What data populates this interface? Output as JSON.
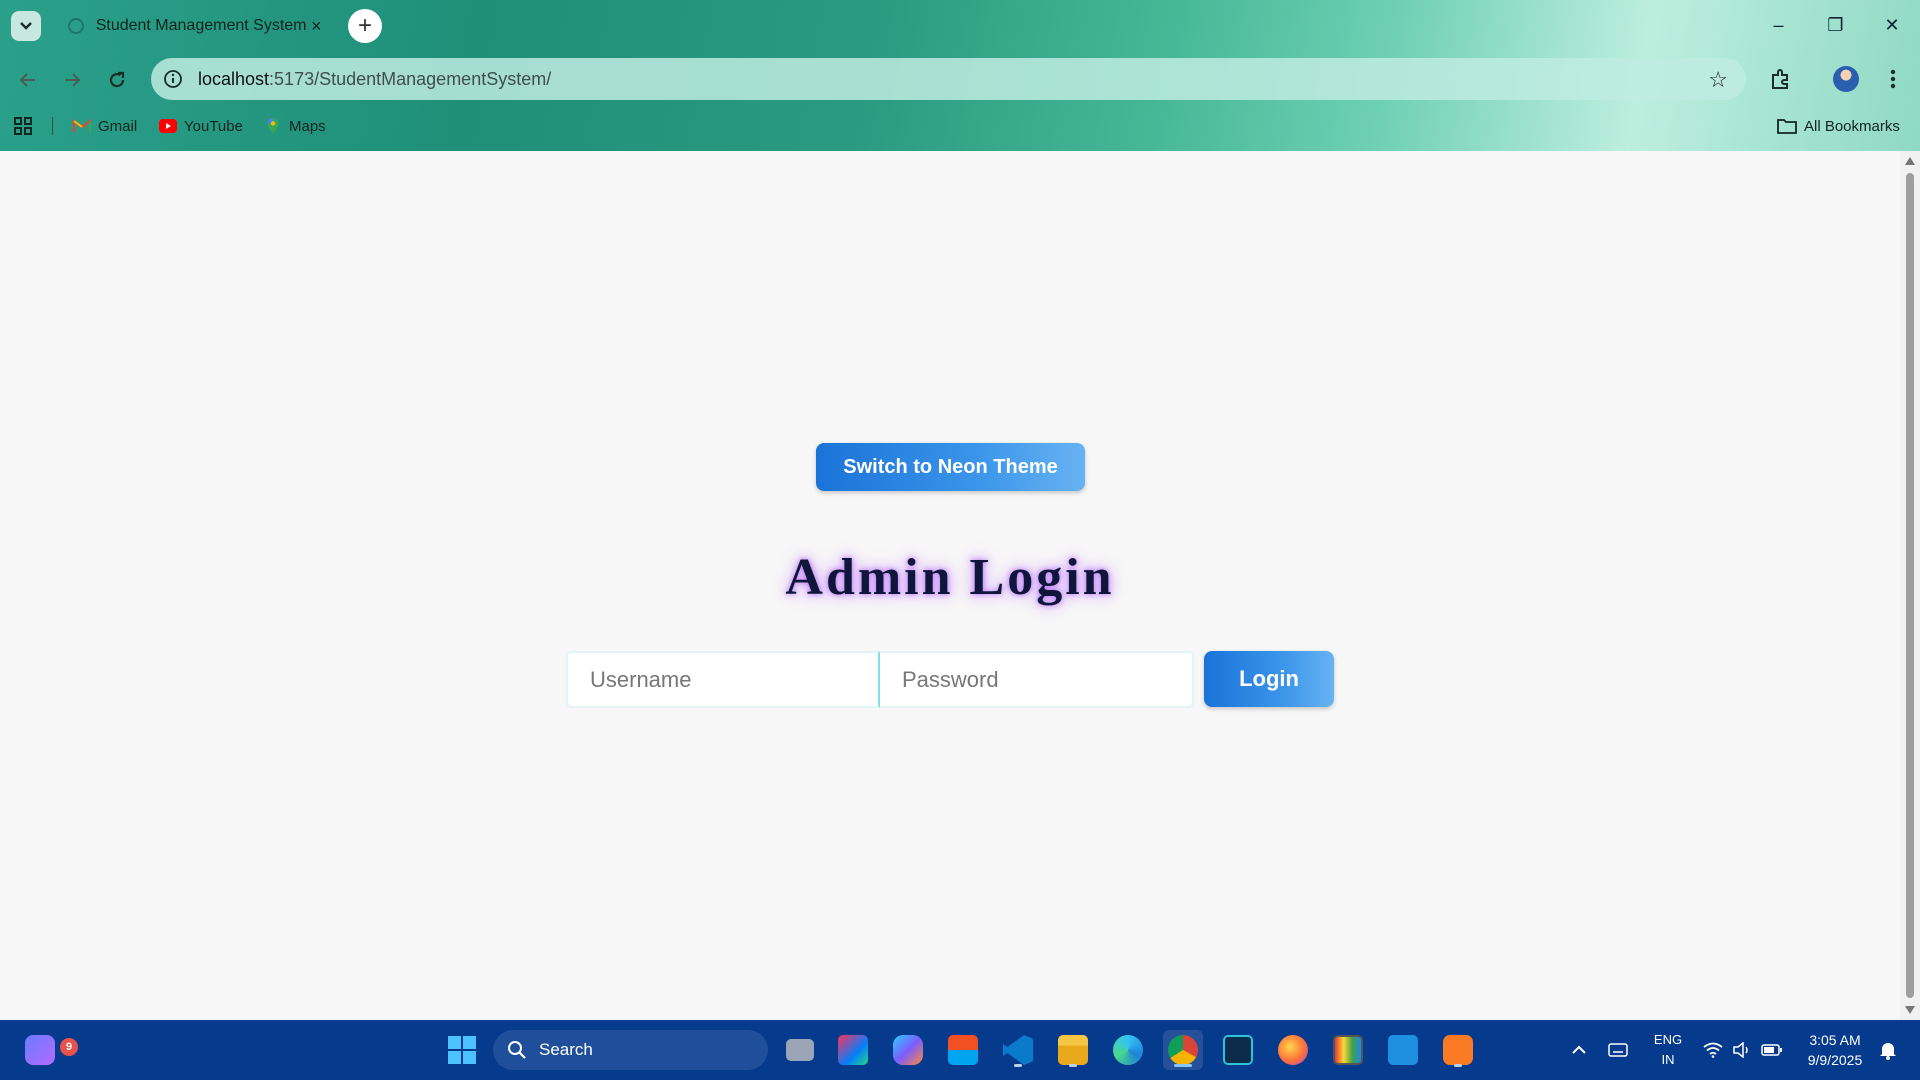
{
  "browser": {
    "tab_title": "Student Management System",
    "tab_close": "×",
    "new_tab": "+",
    "url_host": "localhost",
    "url_path": ":5173/StudentManagementSystem/",
    "bookmarks": [
      {
        "label": "Gmail",
        "icon": "gmail-icon"
      },
      {
        "label": "YouTube",
        "icon": "youtube-icon"
      },
      {
        "label": "Maps",
        "icon": "maps-icon"
      }
    ],
    "all_bookmarks": "All Bookmarks",
    "window_controls": {
      "minimize": "–",
      "restore": "❐",
      "close": "✕"
    }
  },
  "page": {
    "theme_button": "Switch to Neon Theme",
    "title": "Admin Login",
    "username_placeholder": "Username",
    "password_placeholder": "Password",
    "login_button": "Login",
    "colors": {
      "button_gradient_start": "#1a73d8",
      "button_gradient_end": "#67b3f2",
      "title_text": "#10163a",
      "title_glow": "#b46bf5",
      "page_background": "#f7f7f7"
    }
  },
  "taskbar": {
    "search_label": "Search",
    "notification_count": "9",
    "language": {
      "line1": "ENG",
      "line2": "IN"
    },
    "time": "3:05 AM",
    "date": "9/9/2025",
    "apps": [
      "start-icon",
      "file-explorer-icon",
      "intellij-icon",
      "copilot-icon",
      "store-icon",
      "vscode-icon",
      "folder-icon",
      "edge-icon",
      "chrome-icon",
      "app-icon",
      "firefox-icon",
      "app-icon",
      "app-icon",
      "xampp-icon"
    ]
  }
}
